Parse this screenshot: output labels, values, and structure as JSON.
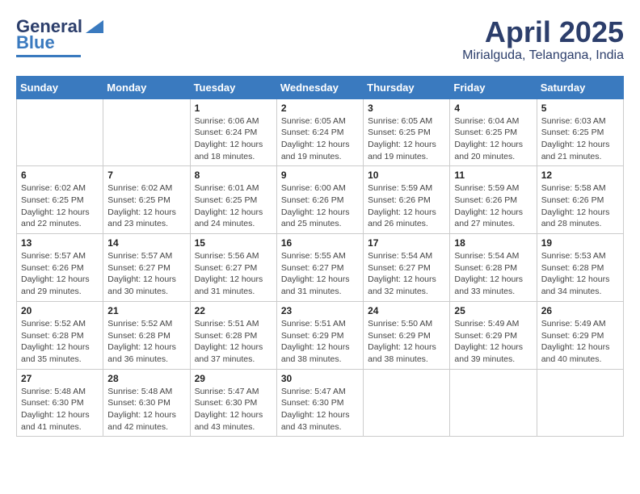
{
  "header": {
    "logo_general": "General",
    "logo_blue": "Blue",
    "month_title": "April 2025",
    "location": "Mirialguda, Telangana, India"
  },
  "weekdays": [
    "Sunday",
    "Monday",
    "Tuesday",
    "Wednesday",
    "Thursday",
    "Friday",
    "Saturday"
  ],
  "weeks": [
    [
      {
        "day": "",
        "info": ""
      },
      {
        "day": "",
        "info": ""
      },
      {
        "day": "1",
        "info": "Sunrise: 6:06 AM\nSunset: 6:24 PM\nDaylight: 12 hours and 18 minutes."
      },
      {
        "day": "2",
        "info": "Sunrise: 6:05 AM\nSunset: 6:24 PM\nDaylight: 12 hours and 19 minutes."
      },
      {
        "day": "3",
        "info": "Sunrise: 6:05 AM\nSunset: 6:25 PM\nDaylight: 12 hours and 19 minutes."
      },
      {
        "day": "4",
        "info": "Sunrise: 6:04 AM\nSunset: 6:25 PM\nDaylight: 12 hours and 20 minutes."
      },
      {
        "day": "5",
        "info": "Sunrise: 6:03 AM\nSunset: 6:25 PM\nDaylight: 12 hours and 21 minutes."
      }
    ],
    [
      {
        "day": "6",
        "info": "Sunrise: 6:02 AM\nSunset: 6:25 PM\nDaylight: 12 hours and 22 minutes."
      },
      {
        "day": "7",
        "info": "Sunrise: 6:02 AM\nSunset: 6:25 PM\nDaylight: 12 hours and 23 minutes."
      },
      {
        "day": "8",
        "info": "Sunrise: 6:01 AM\nSunset: 6:25 PM\nDaylight: 12 hours and 24 minutes."
      },
      {
        "day": "9",
        "info": "Sunrise: 6:00 AM\nSunset: 6:26 PM\nDaylight: 12 hours and 25 minutes."
      },
      {
        "day": "10",
        "info": "Sunrise: 5:59 AM\nSunset: 6:26 PM\nDaylight: 12 hours and 26 minutes."
      },
      {
        "day": "11",
        "info": "Sunrise: 5:59 AM\nSunset: 6:26 PM\nDaylight: 12 hours and 27 minutes."
      },
      {
        "day": "12",
        "info": "Sunrise: 5:58 AM\nSunset: 6:26 PM\nDaylight: 12 hours and 28 minutes."
      }
    ],
    [
      {
        "day": "13",
        "info": "Sunrise: 5:57 AM\nSunset: 6:26 PM\nDaylight: 12 hours and 29 minutes."
      },
      {
        "day": "14",
        "info": "Sunrise: 5:57 AM\nSunset: 6:27 PM\nDaylight: 12 hours and 30 minutes."
      },
      {
        "day": "15",
        "info": "Sunrise: 5:56 AM\nSunset: 6:27 PM\nDaylight: 12 hours and 31 minutes."
      },
      {
        "day": "16",
        "info": "Sunrise: 5:55 AM\nSunset: 6:27 PM\nDaylight: 12 hours and 31 minutes."
      },
      {
        "day": "17",
        "info": "Sunrise: 5:54 AM\nSunset: 6:27 PM\nDaylight: 12 hours and 32 minutes."
      },
      {
        "day": "18",
        "info": "Sunrise: 5:54 AM\nSunset: 6:28 PM\nDaylight: 12 hours and 33 minutes."
      },
      {
        "day": "19",
        "info": "Sunrise: 5:53 AM\nSunset: 6:28 PM\nDaylight: 12 hours and 34 minutes."
      }
    ],
    [
      {
        "day": "20",
        "info": "Sunrise: 5:52 AM\nSunset: 6:28 PM\nDaylight: 12 hours and 35 minutes."
      },
      {
        "day": "21",
        "info": "Sunrise: 5:52 AM\nSunset: 6:28 PM\nDaylight: 12 hours and 36 minutes."
      },
      {
        "day": "22",
        "info": "Sunrise: 5:51 AM\nSunset: 6:28 PM\nDaylight: 12 hours and 37 minutes."
      },
      {
        "day": "23",
        "info": "Sunrise: 5:51 AM\nSunset: 6:29 PM\nDaylight: 12 hours and 38 minutes."
      },
      {
        "day": "24",
        "info": "Sunrise: 5:50 AM\nSunset: 6:29 PM\nDaylight: 12 hours and 38 minutes."
      },
      {
        "day": "25",
        "info": "Sunrise: 5:49 AM\nSunset: 6:29 PM\nDaylight: 12 hours and 39 minutes."
      },
      {
        "day": "26",
        "info": "Sunrise: 5:49 AM\nSunset: 6:29 PM\nDaylight: 12 hours and 40 minutes."
      }
    ],
    [
      {
        "day": "27",
        "info": "Sunrise: 5:48 AM\nSunset: 6:30 PM\nDaylight: 12 hours and 41 minutes."
      },
      {
        "day": "28",
        "info": "Sunrise: 5:48 AM\nSunset: 6:30 PM\nDaylight: 12 hours and 42 minutes."
      },
      {
        "day": "29",
        "info": "Sunrise: 5:47 AM\nSunset: 6:30 PM\nDaylight: 12 hours and 43 minutes."
      },
      {
        "day": "30",
        "info": "Sunrise: 5:47 AM\nSunset: 6:30 PM\nDaylight: 12 hours and 43 minutes."
      },
      {
        "day": "",
        "info": ""
      },
      {
        "day": "",
        "info": ""
      },
      {
        "day": "",
        "info": ""
      }
    ]
  ]
}
